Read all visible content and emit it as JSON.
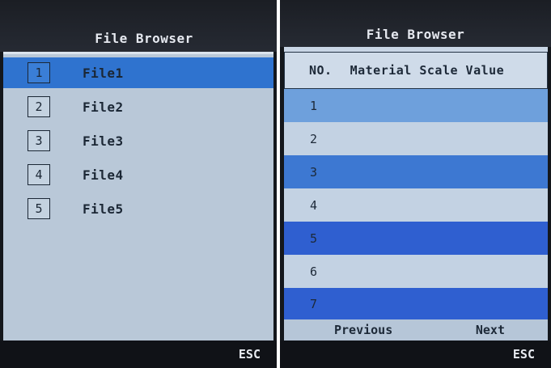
{
  "left_screen": {
    "title": "File Browser",
    "files": [
      {
        "num": "1",
        "name": "File1",
        "selected": true
      },
      {
        "num": "2",
        "name": "File2",
        "selected": false
      },
      {
        "num": "3",
        "name": "File3",
        "selected": false
      },
      {
        "num": "4",
        "name": "File4",
        "selected": false
      },
      {
        "num": "5",
        "name": "File5",
        "selected": false
      }
    ],
    "esc_label": "ESC"
  },
  "right_screen": {
    "title": "File Browser",
    "header": {
      "no": "NO.",
      "material_scale_value": "Material Scale Value"
    },
    "rows": [
      "1",
      "2",
      "3",
      "4",
      "5",
      "6",
      "7"
    ],
    "previous_label": "Previous",
    "next_label": "Next",
    "esc_label": "ESC"
  },
  "colors": {
    "selection_blue": "#2f73cf",
    "panel_gray_blue": "#b9c8d8",
    "row_light": "#c3d2e3",
    "row_blue": "#3d78d2"
  }
}
